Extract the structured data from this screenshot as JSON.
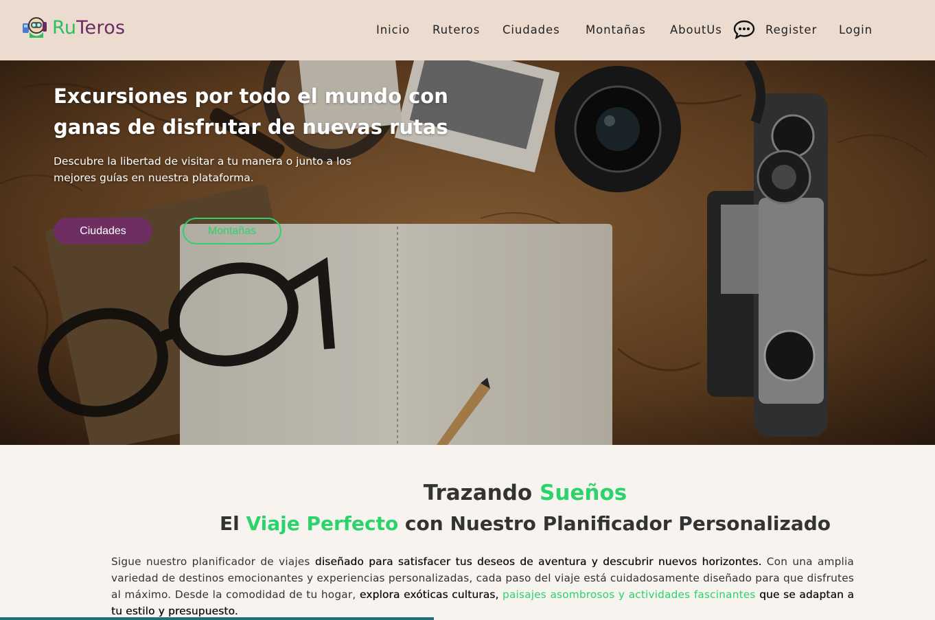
{
  "brand": {
    "ru": "Ru",
    "teros": "Teros"
  },
  "nav": {
    "items": [
      "Inicio",
      "Ruteros",
      "Ciudades",
      "Montañas",
      "AboutUs"
    ],
    "register": "Register",
    "login": "Login"
  },
  "hero": {
    "title": "Excursiones por todo el mundo con ganas de disfrutar de nuevas rutas",
    "subtitle": "Descubre la libertad de visitar a tu manera o junto a los mejores guías en nuestra plataforma.",
    "btn_primary": "Ciudades",
    "btn_secondary": "Montañas"
  },
  "section": {
    "h1_plain": "Trazando ",
    "h1_accent": "Sueños",
    "h2_pre": "El ",
    "h2_accent": "Viaje Perfecto",
    "h2_post": " con Nuestro Planificador Personalizado",
    "p1": "Sigue nuestro planificador de viajes ",
    "p2": "diseñado para satisfacer tus deseos de aventura y descubrir nuevos horizontes.",
    "p3": " Con una amplia variedad de destinos emocionantes y experiencias personalizadas, cada paso del viaje está cuidadosamente diseñado para que disfrutes al máximo. Desde la comodidad de tu hogar, ",
    "p4": "explora exóticas culturas,",
    "p5": " ",
    "p6": "paisajes asombrosos y actividades fascinantes",
    "p7": " ",
    "p8": "que se adaptan a tu estilo y presupuesto."
  },
  "colors": {
    "accent_green": "#2bd36a",
    "brand_purple": "#6e2e62",
    "nav_bg": "#ecdccf",
    "page_bg": "#f7f3ef"
  }
}
